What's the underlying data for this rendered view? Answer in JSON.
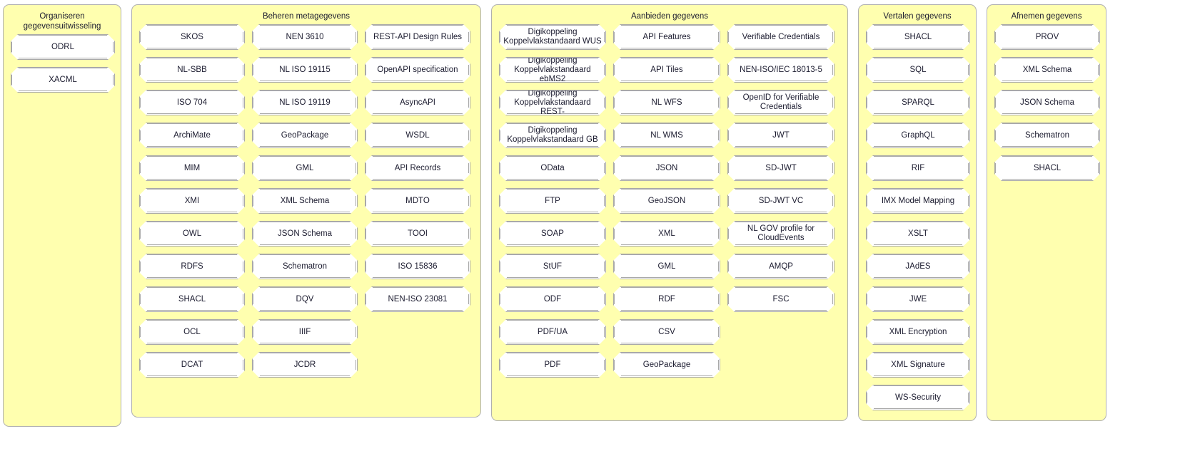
{
  "columns": [
    {
      "id": "organiseren",
      "title": "Organiseren\ngegevensuitwisseling",
      "subcolumns": [
        {
          "items": [
            "ODRL",
            "XACML"
          ]
        }
      ]
    },
    {
      "id": "beheren",
      "title": "Beheren metagegevens",
      "subcolumns": [
        {
          "items": [
            "SKOS",
            "NL-SBB",
            "ISO 704",
            "ArchiMate",
            "MIM",
            "XMI",
            "OWL",
            "RDFS",
            "SHACL",
            "OCL",
            "DCAT"
          ]
        },
        {
          "items": [
            "NEN 3610",
            "NL ISO 19115",
            "NL ISO 19119",
            "GeoPackage",
            "GML",
            "XML Schema",
            "JSON Schema",
            "Schematron",
            "DQV",
            "IIIF",
            "JCDR"
          ]
        },
        {
          "items": [
            "REST-API Design Rules",
            "OpenAPI specification",
            "AsyncAPI",
            "WSDL",
            "API Records",
            "MDTO",
            "TOOI",
            "ISO 15836",
            "NEN-ISO 23081"
          ]
        }
      ]
    },
    {
      "id": "aanbieden",
      "title": "Aanbieden gegevens",
      "subcolumns": [
        {
          "items": [
            "Digikoppeling\nKoppelvlakstandaard WUS",
            "Digikoppeling\nKoppelvlakstandaard ebMS2",
            "Digikoppeling\nKoppelvlakstandaard REST-",
            "Digikoppeling\nKoppelvlakstandaard GB",
            "OData",
            "FTP",
            "SOAP",
            "StUF",
            "ODF",
            "PDF/UA",
            "PDF"
          ]
        },
        {
          "items": [
            "API Features",
            "API Tiles",
            "NL WFS",
            "NL WMS",
            "JSON",
            "GeoJSON",
            "XML",
            "GML",
            "RDF",
            "CSV",
            "GeoPackage"
          ]
        },
        {
          "items": [
            "Verifiable Credentials",
            "NEN-ISO/IEC 18013-5",
            "OpenID for Verifiable\nCredentials",
            "JWT",
            "SD-JWT",
            "SD-JWT VC",
            "NL GOV profile for\nCloudEvents",
            "AMQP",
            "FSC"
          ]
        }
      ]
    },
    {
      "id": "vertalen",
      "title": "Vertalen gegevens",
      "subcolumns": [
        {
          "items": [
            "SHACL",
            "SQL",
            "SPARQL",
            "GraphQL",
            "RIF",
            "IMX Model Mapping",
            "XSLT",
            "JAdES",
            "JWE",
            "XML Encryption",
            "XML Signature",
            "WS-Security"
          ]
        }
      ]
    },
    {
      "id": "afnemen",
      "title": "Afnemen gegevens",
      "subcolumns": [
        {
          "items": [
            "PROV",
            "XML Schema",
            "JSON Schema",
            "Schematron",
            "SHACL"
          ]
        }
      ]
    }
  ],
  "colors": {
    "panel_background": "#ffffaf",
    "panel_border": "#b0b0b0",
    "node_background": "#ffffff",
    "node_border": "#a9a9a9",
    "text": "#1b1b2f",
    "page_background": "#ffffff"
  }
}
